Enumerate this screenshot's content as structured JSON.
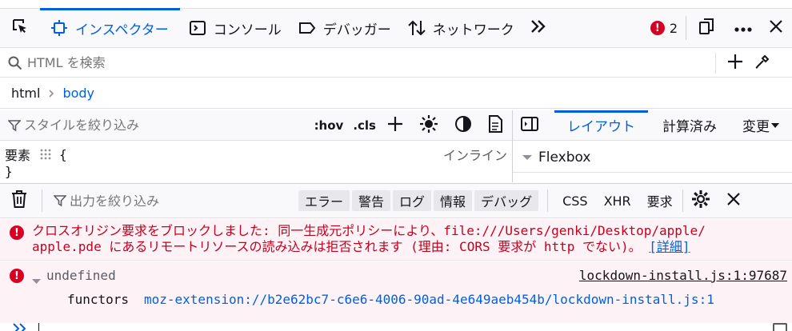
{
  "toolbar": {
    "tabs": [
      {
        "label": "インスペクター"
      },
      {
        "label": "コンソール"
      },
      {
        "label": "デバッガー"
      },
      {
        "label": "ネットワーク"
      }
    ],
    "error_count": "2"
  },
  "search": {
    "placeholder": "HTML を検索"
  },
  "breadcrumb": {
    "items": [
      "html",
      "body"
    ]
  },
  "rules": {
    "filter_placeholder": "スタイルを絞り込み",
    "hov_label": ":hov",
    "cls_label": ".cls",
    "element_label": "要素",
    "open_brace": "{",
    "close_brace": "}",
    "inline_label": "インライン"
  },
  "layout": {
    "tabs": [
      "レイアウト",
      "計算済み",
      "変更"
    ],
    "flexbox_label": "Flexbox"
  },
  "console": {
    "filter_placeholder": "出力を絞り込み",
    "filters": [
      "エラー",
      "警告",
      "ログ",
      "情報",
      "デバッグ"
    ],
    "extras": [
      "CSS",
      "XHR",
      "要求"
    ]
  },
  "messages": {
    "cors_line1": "クロスオリジン要求をブロックしました: 同一生成元ポリシーにより、file:///Users/genki/Desktop/apple/",
    "cors_line2": "apple.pde にあるリモートリソースの読み込みは拒否されます (理由: CORS 要求が http でない)。",
    "details_link": "[詳細]",
    "undefined_label": "undefined",
    "source_link": "lockdown-install.js:1:97687",
    "functors_label": "functors",
    "functors_url": "moz-extension://b2e62bc7-c6e6-4006-90ad-4e649aeb454b/lockdown-install.js:1"
  },
  "colors": {
    "accent": "#0060df",
    "error": "#d70022",
    "error_bg": "#fdf2f5"
  },
  "icons": [
    "pick-element-icon",
    "inspector-icon",
    "console-icon",
    "debugger-icon",
    "network-icon",
    "overflow-chevrons-icon",
    "error-icon",
    "dock-icon",
    "more-icon",
    "close-icon",
    "search-icon",
    "add-icon",
    "eyedropper-icon",
    "filter-icon",
    "light-theme-icon",
    "dark-theme-icon",
    "print-icon",
    "toggle-sidebar-icon",
    "trash-icon",
    "gear-icon"
  ]
}
